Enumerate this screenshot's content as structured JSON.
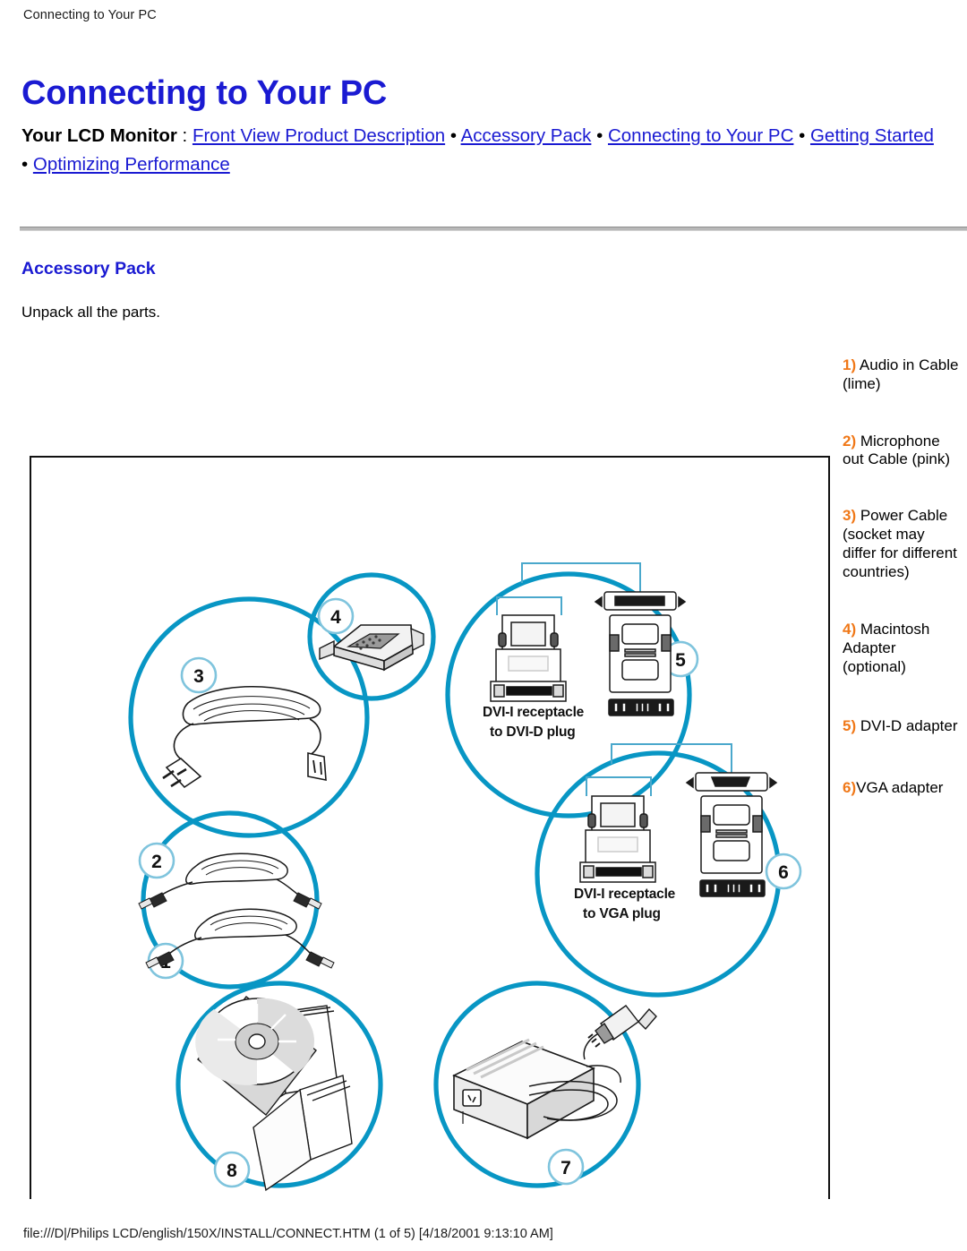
{
  "document": {
    "running_header": "Connecting to Your PC",
    "title": "Connecting to Your PC",
    "status_bar": "file:///D|/Philips LCD/english/150X/INSTALL/CONNECT.HTM (1 of 5) [4/18/2001 9:13:10 AM]"
  },
  "breadcrumb": {
    "lead": "Your LCD Monitor",
    "colon": " : ",
    "separator": " • ",
    "links": [
      "Front View Product Description",
      "Accessory Pack",
      "Connecting to Your PC",
      "Getting Started ",
      "Optimizing Performance"
    ]
  },
  "section": {
    "heading": "Accessory Pack",
    "intro": "Unpack all the parts."
  },
  "legend": {
    "items": [
      {
        "num": "1)",
        "text": " Audio in Cable (lime)"
      },
      {
        "num": "2)",
        "text": " Microphone out Cable (pink)"
      },
      {
        "num": "3)",
        "text": " Power Cable (socket may differ for different countries)"
      },
      {
        "num": "4)",
        "text": " Macintosh Adapter (optional)"
      },
      {
        "num": "5)",
        "text": " DVI-D adapter"
      },
      {
        "num": "6)",
        "text": "VGA adapter"
      }
    ]
  },
  "figure": {
    "callouts": [
      "1",
      "2",
      "3",
      "4",
      "5",
      "6",
      "7",
      "8"
    ],
    "labels": [
      {
        "line1": "DVI-I receptacle",
        "line2": "to DVI-D plug"
      },
      {
        "line1": "DVI-I receptacle",
        "line2": "to VGA plug"
      }
    ],
    "colors": {
      "circle_stroke": "#0896c4",
      "callout_stroke": "#7fc4dd",
      "line_art": "#1a1a1a",
      "shade": "#d6d6d6"
    }
  }
}
